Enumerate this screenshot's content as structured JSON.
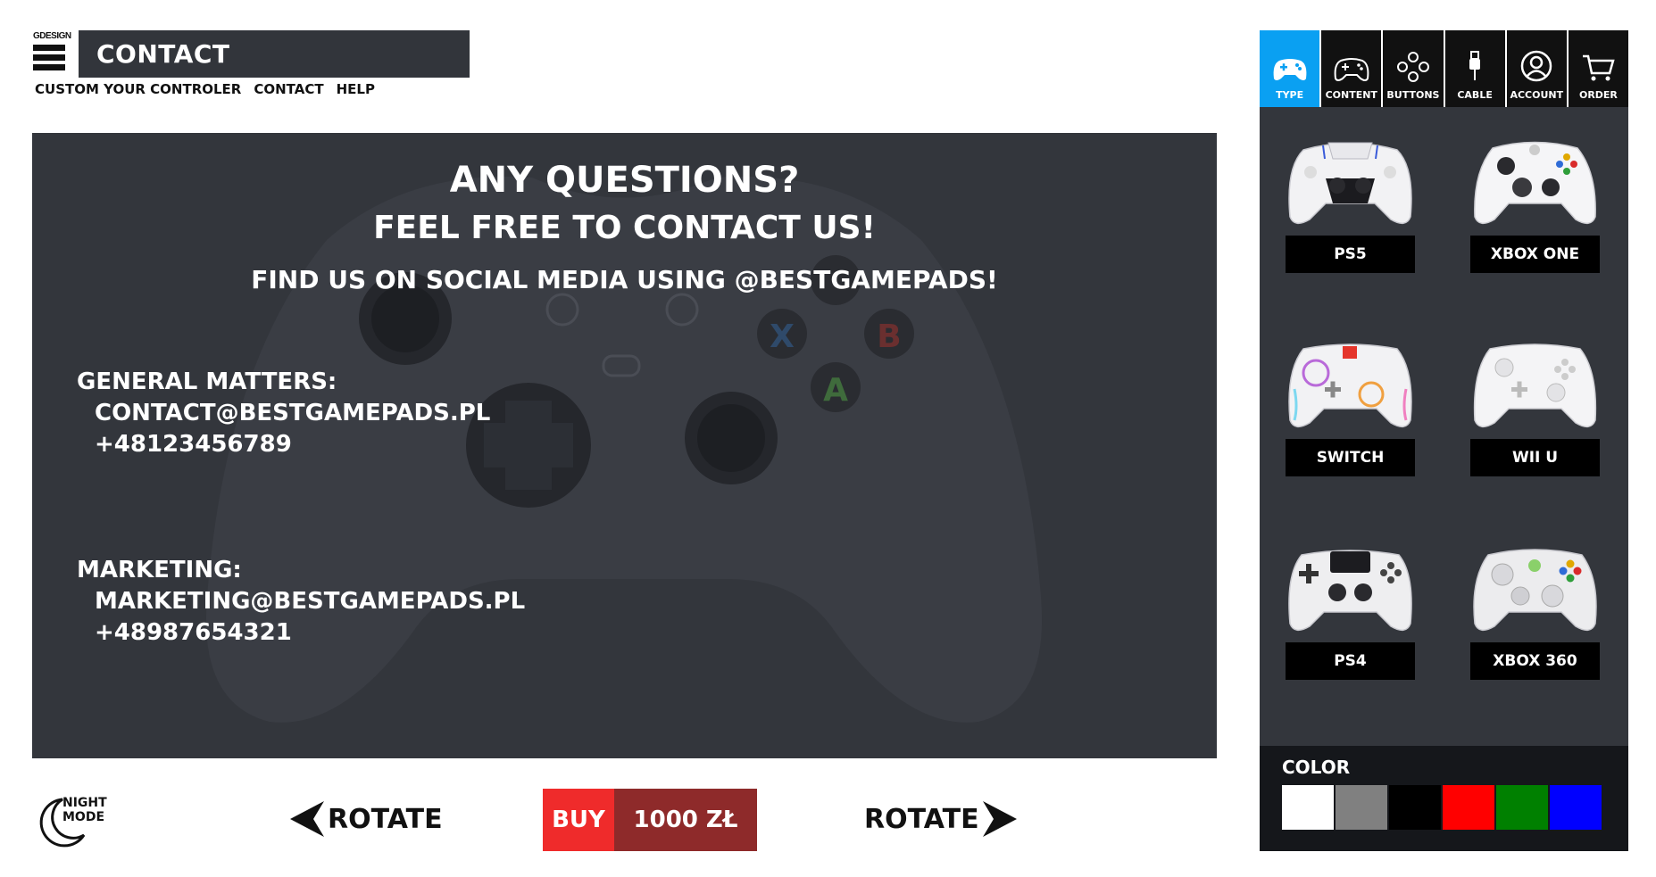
{
  "header": {
    "logo_text": "GDESIGN",
    "title": "CONTACT",
    "nav": [
      "CUSTOM YOUR CONTROLER",
      "CONTACT",
      "HELP"
    ]
  },
  "main": {
    "heading1": "ANY QUESTIONS?",
    "heading2": "FEEL FREE TO CONTACT US!",
    "heading3": "FIND US ON SOCIAL MEDIA USING @BESTGAMEPADS!",
    "general": {
      "label": "GENERAL MATTERS:",
      "email": "CONTACT@BESTGAMEPADS.PL",
      "phone": "+48123456789"
    },
    "marketing": {
      "label": "MARKETING:",
      "email": "MARKETING@BESTGAMEPADS.PL",
      "phone": "+48987654321"
    }
  },
  "bottom": {
    "night_mode": [
      "NIGHT",
      "MODE"
    ],
    "rotate_left": "ROTATE",
    "rotate_right": "ROTATE",
    "buy_label": "BUY",
    "price": "1000 ZŁ"
  },
  "sidebar": {
    "tabs": [
      {
        "label": "TYPE",
        "icon": "gamepad-icon",
        "active": true
      },
      {
        "label": "CONTENT",
        "icon": "gamepad-outline-icon",
        "active": false
      },
      {
        "label": "BUTTONS",
        "icon": "buttons-icon",
        "active": false
      },
      {
        "label": "CABLE",
        "icon": "cable-icon",
        "active": false
      },
      {
        "label": "ACCOUNT",
        "icon": "account-icon",
        "active": false
      },
      {
        "label": "ORDER",
        "icon": "cart-icon",
        "active": false
      }
    ],
    "controllers": [
      "PS5",
      "XBOX ONE",
      "SWITCH",
      "WII U",
      "PS4",
      "XBOX 360"
    ],
    "color_title": "COLOR",
    "colors": [
      "#ffffff",
      "#808080",
      "#000000",
      "#ff0000",
      "#008000",
      "#0000ff"
    ]
  },
  "colors": {
    "panel_bg": "#33363c",
    "active_tab": "#0aa0f2",
    "buy_red": "#ef2b2b",
    "price_red": "#8e2a2a"
  }
}
